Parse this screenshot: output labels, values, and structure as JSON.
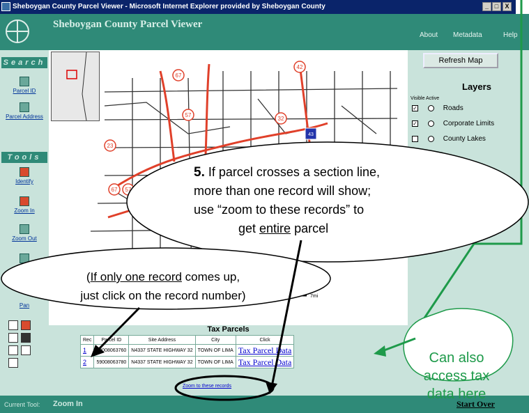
{
  "window": {
    "title": "Sheboygan County Parcel Viewer - Microsoft Internet Explorer provided by Sheboygan County",
    "buttons": [
      "_",
      "□",
      "X"
    ]
  },
  "header": {
    "title": "Sheboygan County Parcel Viewer",
    "nav": [
      "About",
      "Metadata",
      "Help"
    ]
  },
  "sidebar": {
    "search_heading": "Search",
    "search_items": [
      "Parcel ID",
      "Parcel Address"
    ],
    "tools_heading": "Tools",
    "tool_items": [
      "Identify",
      "Zoom In",
      "Zoom Out"
    ],
    "pan_label": "Pan"
  },
  "status": {
    "current_tool_label": "Current Tool:",
    "current_tool_value": "Zoom In"
  },
  "right_panel": {
    "refresh_label": "Refresh Map",
    "layers_title": "Layers",
    "layers_subheading": "Visible Active",
    "layers": [
      {
        "name": "Roads",
        "visible": true
      },
      {
        "name": "Corporate Limits",
        "visible": true
      },
      {
        "name": "County Lakes",
        "visible": false
      }
    ]
  },
  "map": {
    "highway_labels": [
      "43",
      "67",
      "57",
      "32",
      "23",
      "67",
      "57",
      "42"
    ],
    "scale_label": "7mi"
  },
  "tax_parcels": {
    "title": "Tax Parcels",
    "headers": [
      "Rec",
      "Parcel ID",
      "Site Address",
      "City",
      "Click"
    ],
    "rows": [
      {
        "rec": "1",
        "parcel_id": "59008063760",
        "address": "N4337 STATE HIGHWAY 32",
        "city": "TOWN OF LIMA",
        "link": "Tax Parcel Data"
      },
      {
        "rec": "2",
        "parcel_id": "59008063780",
        "address": "N4337 STATE HIGHWAY 32",
        "city": "TOWN OF LIMA",
        "link": "Tax Parcel Data"
      }
    ],
    "zoom_link": "Zoom to these records"
  },
  "start_over": "Start Over",
  "callouts": {
    "parcel_step_number": "5.",
    "parcel_line1": "If parcel crosses a section line,",
    "parcel_line2": "more than one record will show;",
    "parcel_line3": "use “zoom to these records” to",
    "parcel_line4_pre": "get ",
    "parcel_line4_u": "entire",
    "parcel_line4_post": " parcel",
    "one_record_pre": "(",
    "one_record_u": "If only one record",
    "one_record_post": " comes up,",
    "one_record_line2": "just click on the record number)",
    "tax_line1": "Can also",
    "tax_line2": "access tax",
    "tax_line3": "data here"
  },
  "colors": {
    "header_teal": "#2f8a78",
    "panel_mint": "#c9e3db",
    "callout_green": "#1e9a4a",
    "road_red": "#e0402a"
  }
}
